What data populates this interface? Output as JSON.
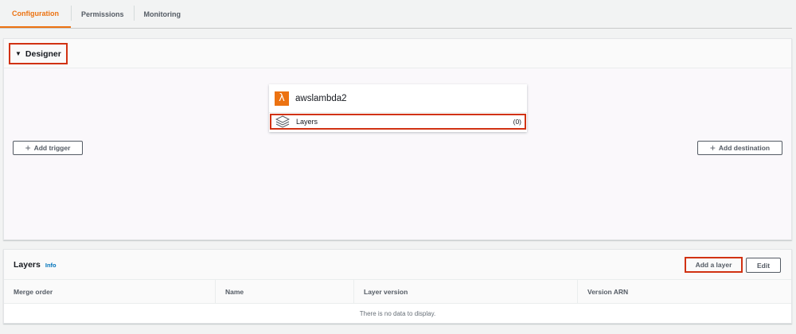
{
  "tabs": [
    {
      "label": "Configuration",
      "active": true
    },
    {
      "label": "Permissions",
      "active": false
    },
    {
      "label": "Monitoring",
      "active": false
    }
  ],
  "designer": {
    "title": "Designer",
    "function": {
      "name": "awslambda2",
      "icon": "lambda-icon"
    },
    "layers": {
      "label": "Layers",
      "count": "(0)",
      "icon": "layers-icon"
    },
    "add_trigger": "Add trigger",
    "add_destination": "Add destination"
  },
  "layers_panel": {
    "title": "Layers",
    "info": "Info",
    "add_layer": "Add a layer",
    "edit": "Edit",
    "columns": [
      "Merge order",
      "Name",
      "Layer version",
      "Version ARN"
    ],
    "empty_message": "There is no data to display."
  },
  "colors": {
    "accent": "#ec7211",
    "highlight": "#d13212",
    "link": "#0073bb"
  }
}
